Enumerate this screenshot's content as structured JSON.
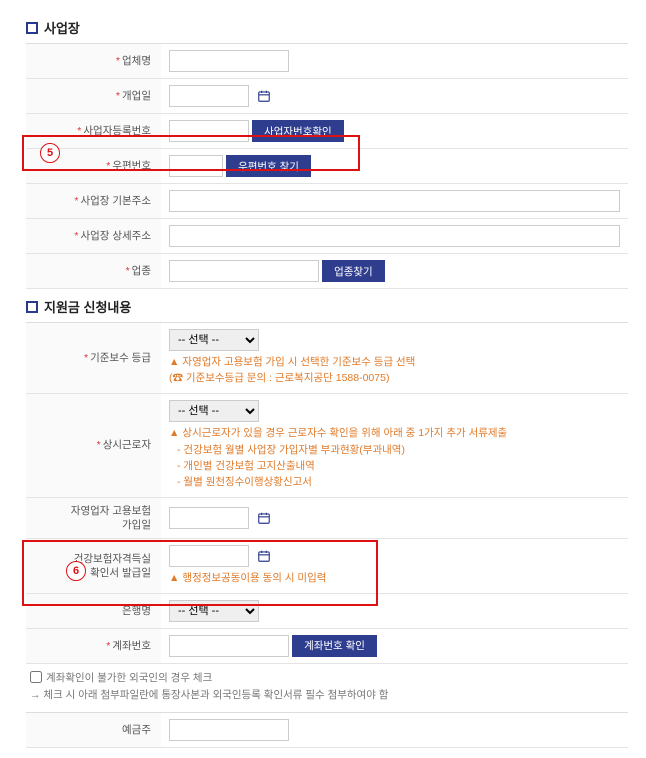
{
  "sections": {
    "workplace": {
      "title": "사업장"
    },
    "application": {
      "title": "지원금 신청내용"
    }
  },
  "workplace": {
    "company_name_label": "업체명",
    "open_date_label": "개업일",
    "biz_reg_no_label": "사업자등록번호",
    "biz_reg_no_btn": "사업자번호확인",
    "postal_code_label": "우편번호",
    "postal_code_btn": "우편번호 찾기",
    "base_addr_label": "사업장 기본주소",
    "detail_addr_label": "사업장 상세주소",
    "industry_label": "업종",
    "industry_btn": "업종찾기"
  },
  "app": {
    "grade": {
      "label": "기준보수 등급",
      "select_placeholder": "-- 선택 --",
      "help1": "자영업자 고용보험 가입 시 선택한 기준보수 등급 선택",
      "help2": "(☎ 기준보수등급 문의 : 근로복지공단 1588-0075)"
    },
    "workers": {
      "label": "상시근로자",
      "select_placeholder": "-- 선택 --",
      "help_title": "상시근로자가 있을 경우 근로자수 확인을 위해 아래 중 1가지 추가 서류제출",
      "help_items": [
        "건강보험 월별 사업장 가입자별 부과현황(부과내역)",
        "개인별 건강보험 고지산출내역",
        "월별 원천징수이행상황신고서"
      ]
    },
    "self_emp_ins": {
      "label": "자영업자 고용보험\n가입일"
    },
    "health_ins": {
      "label": "건강보험자격득실\n확인서 발급일",
      "help": "행정정보공동이용 동의 시 미입력"
    },
    "bank": {
      "label": "은행명",
      "select_placeholder": "-- 선택 --"
    },
    "account": {
      "label": "계좌번호",
      "btn": "계좌번호 확인"
    }
  },
  "footnote": {
    "line1": "계좌확인이 불가한 외국인의 경우 체크",
    "line2": "→ 체크 시 아래 첨부파일란에 통장사본과 외국인등록 확인서류 필수 첨부하여야 함"
  },
  "deposit_holder_label": "예금주",
  "annotations": {
    "a5": "5",
    "a6": "6"
  }
}
